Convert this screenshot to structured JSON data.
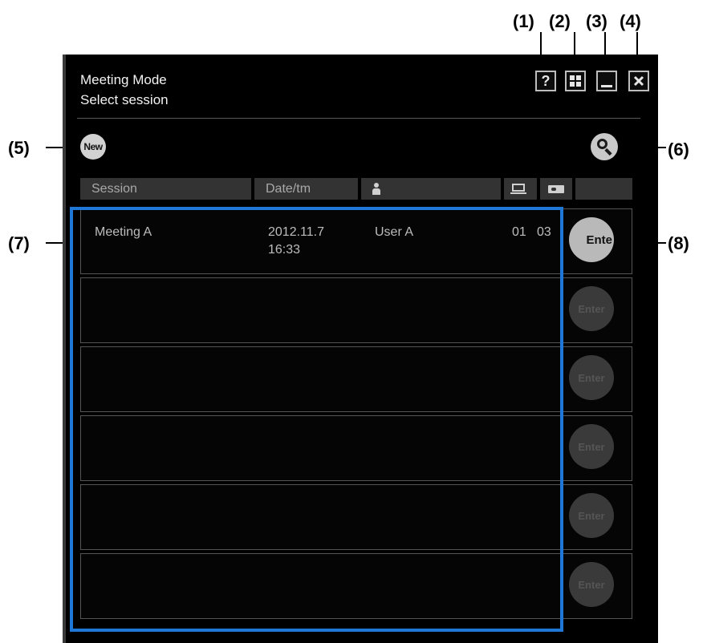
{
  "callouts": {
    "c1": "(1)",
    "c2": "(2)",
    "c3": "(3)",
    "c4": "(4)",
    "c5": "(5)",
    "c6": "(6)",
    "c7": "(7)",
    "c8": "(8)"
  },
  "window": {
    "title": "Meeting Mode",
    "subtitle": "Select session",
    "help_label": "?"
  },
  "toolbar": {
    "new_label": "New"
  },
  "table": {
    "headers": {
      "session": "Session",
      "datetime": "Date/tm"
    },
    "rows": [
      {
        "session": "Meeting A",
        "date": "2012.11.7",
        "time": "16:33",
        "user": "User A",
        "pc_count": "01",
        "proj_count": "03",
        "enter": "Ente"
      },
      {
        "enter": "Enter"
      },
      {
        "enter": "Enter"
      },
      {
        "enter": "Enter"
      },
      {
        "enter": "Enter"
      },
      {
        "enter": "Enter"
      }
    ]
  },
  "colors": {
    "highlight": "#1f78d6",
    "window_bg": "#000000",
    "header_bg": "#333333"
  },
  "icons": [
    "help-icon",
    "grid-view-icon",
    "minimize-icon",
    "close-icon",
    "search-icon",
    "person-icon",
    "pc-icon",
    "projector-icon"
  ]
}
